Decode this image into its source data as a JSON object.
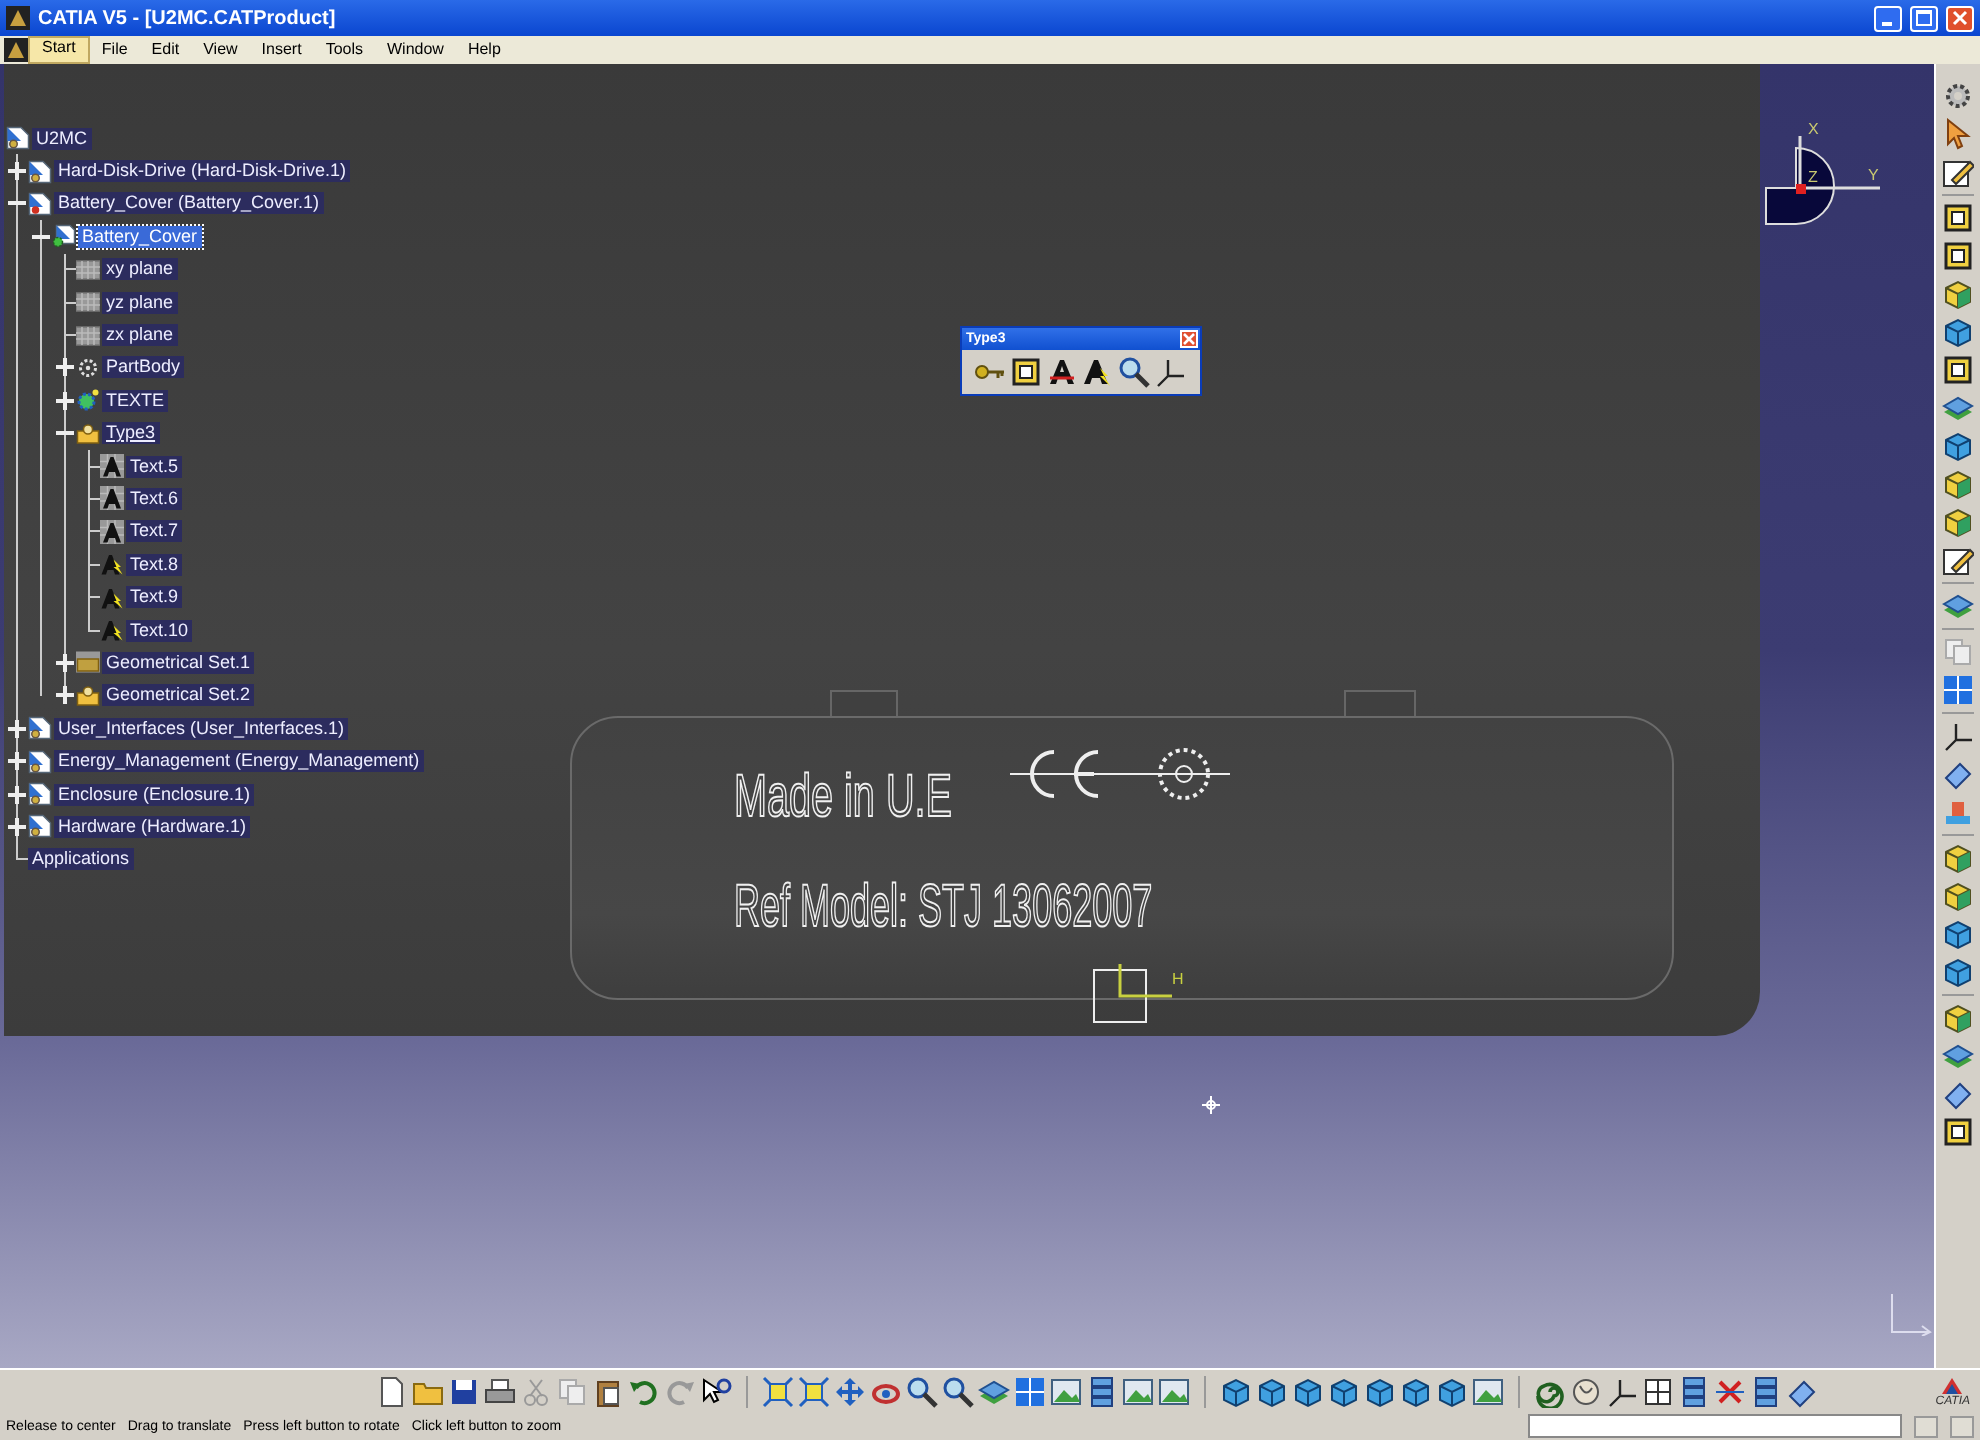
{
  "window": {
    "title": "CATIA V5 - [U2MC.CATProduct]"
  },
  "menu": [
    {
      "label": "Start",
      "selected": true
    },
    {
      "label": "File",
      "selected": false
    },
    {
      "label": "Edit",
      "selected": false
    },
    {
      "label": "View",
      "selected": false
    },
    {
      "label": "Insert",
      "selected": false
    },
    {
      "label": "Tools",
      "selected": false
    },
    {
      "label": "Window",
      "selected": false
    },
    {
      "label": "Help",
      "selected": false
    }
  ],
  "tree": {
    "label": "U2MC",
    "kind": "product",
    "selected": false,
    "in_work": false,
    "children": [
      {
        "label": "Hard-Disk-Drive (Hard-Disk-Drive.1)",
        "kind": "product",
        "expanded": false,
        "selected": false,
        "in_work": false
      },
      {
        "label": "Battery_Cover (Battery_Cover.1)",
        "kind": "part",
        "expanded": true,
        "selected": false,
        "in_work": false,
        "children": [
          {
            "label": "Battery_Cover",
            "kind": "part-active",
            "expanded": true,
            "selected": true,
            "in_work": false,
            "children": [
              {
                "label": "xy plane",
                "kind": "plane",
                "selected": false,
                "in_work": false
              },
              {
                "label": "yz plane",
                "kind": "plane",
                "selected": false,
                "in_work": false
              },
              {
                "label": "zx plane",
                "kind": "plane",
                "selected": false,
                "in_work": false
              },
              {
                "label": "PartBody",
                "kind": "body",
                "expanded": false,
                "selected": false,
                "in_work": false
              },
              {
                "label": "TEXTE",
                "kind": "feature-set",
                "expanded": false,
                "selected": false,
                "in_work": false
              },
              {
                "label": "Type3",
                "kind": "geoset",
                "expanded": true,
                "selected": false,
                "in_work": true,
                "children": [
                  {
                    "label": "Text.5",
                    "kind": "text-hatched",
                    "selected": false,
                    "in_work": false
                  },
                  {
                    "label": "Text.6",
                    "kind": "text-hatched",
                    "selected": false,
                    "in_work": false
                  },
                  {
                    "label": "Text.7",
                    "kind": "text-hatched",
                    "selected": false,
                    "in_work": false
                  },
                  {
                    "label": "Text.8",
                    "kind": "text",
                    "selected": false,
                    "in_work": false
                  },
                  {
                    "label": "Text.9",
                    "kind": "text",
                    "selected": false,
                    "in_work": false
                  },
                  {
                    "label": "Text.10",
                    "kind": "text",
                    "selected": false,
                    "in_work": false
                  }
                ]
              },
              {
                "label": "Geometrical Set.1",
                "kind": "geoset-hatched",
                "expanded": false,
                "selected": false,
                "in_work": false
              },
              {
                "label": "Geometrical Set.2",
                "kind": "geoset",
                "expanded": false,
                "selected": false,
                "in_work": false
              }
            ]
          }
        ]
      },
      {
        "label": "User_Interfaces (User_Interfaces.1)",
        "kind": "product",
        "expanded": false,
        "selected": false,
        "in_work": false
      },
      {
        "label": "Energy_Management (Energy_Management)",
        "kind": "product",
        "expanded": false,
        "selected": false,
        "in_work": false
      },
      {
        "label": "Enclosure (Enclosure.1)",
        "kind": "product",
        "expanded": false,
        "selected": false,
        "in_work": false
      },
      {
        "label": "Hardware (Hardware.1)",
        "kind": "product",
        "expanded": false,
        "selected": false,
        "in_work": false
      },
      {
        "label": "Applications",
        "kind": "none",
        "selected": false,
        "in_work": false
      }
    ]
  },
  "floating_toolbar": {
    "title": "Type3"
  },
  "model_texts": [
    "Made in U.E",
    "Ref Model: STJ 13062007"
  ],
  "axis_label": "H",
  "compass": {
    "x": "X",
    "y": "Y",
    "z": "Z"
  },
  "logo": "CATIA",
  "status_bar": {
    "hints": [
      "Release to center",
      "Drag to translate",
      "Press left button to rotate",
      "Click left button to zoom"
    ]
  }
}
